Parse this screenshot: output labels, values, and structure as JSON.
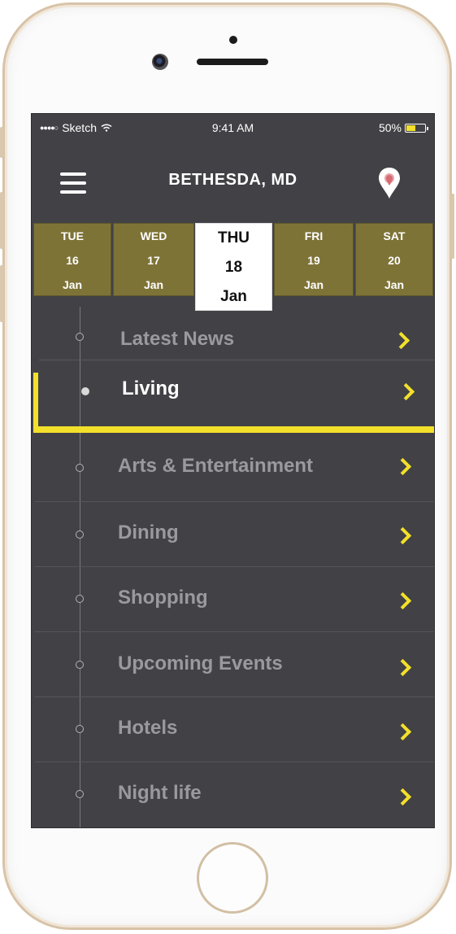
{
  "status_bar": {
    "signal": "●●●●○",
    "carrier": "Sketch",
    "time": "9:41 AM",
    "battery": "50%",
    "battery_level": 0.5
  },
  "header": {
    "menu_icon": "hamburger-menu-icon",
    "title": "BETHESDA, MD",
    "location_icon": "location-pin-icon"
  },
  "dates": [
    {
      "day": "TUE",
      "date": "16",
      "month": "Jan"
    },
    {
      "day": "WED",
      "date": "17",
      "month": "Jan"
    },
    {
      "day": "THU",
      "date": "18",
      "month": "Jan"
    },
    {
      "day": "FRI",
      "date": "19",
      "month": "Jan"
    },
    {
      "day": "SAT",
      "date": "20",
      "month": "Jan"
    }
  ],
  "menu": [
    {
      "label": "Latest News"
    },
    {
      "label": "Living"
    },
    {
      "label": "Arts & Entertainment"
    },
    {
      "label": "Dining"
    },
    {
      "label": "Shopping"
    },
    {
      "label": "Upcoming Events"
    },
    {
      "label": "Hotels"
    },
    {
      "label": "Night life"
    }
  ],
  "colors": {
    "accent": "#f2e02b",
    "date_strip": "#7e7337",
    "background": "#424146"
  }
}
